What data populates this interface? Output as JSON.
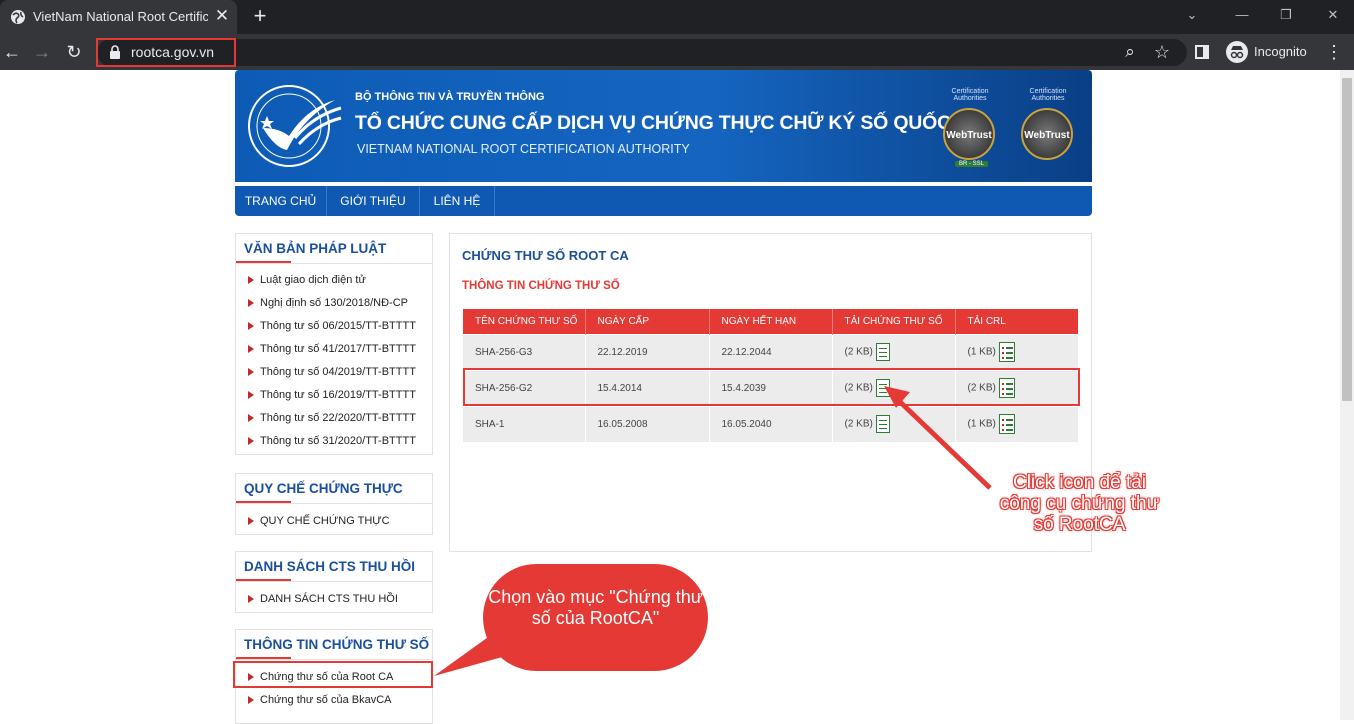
{
  "browser": {
    "tab_title": "VietNam National Root Certificate",
    "tab_close": "✕",
    "new_tab": "+",
    "url": "rootca.gov.vn",
    "incognito_label": "Incognito",
    "win_min": "—",
    "win_max": "❐",
    "win_close": "✕",
    "back": "←",
    "forward": "→",
    "reload": "↻",
    "zoom": "⌕",
    "star": "☆",
    "menu": "⋮"
  },
  "banner": {
    "ministry": "BỘ THÔNG TIN VÀ TRUYỀN THÔNG",
    "org_name": "TỔ CHỨC CUNG CẤP DỊCH VỤ CHỨNG THỰC CHỮ KÝ SỐ QUỐC GIA",
    "org_name_en": "VIETNAM NATIONAL ROOT CERTIFICATION AUTHORITY",
    "badge1_top": "Certification Authorities",
    "badge1_label": "WebTrust",
    "badge1_sub": "BR - SSL",
    "badge2_top": "Certification Authorities",
    "badge2_label": "WebTrust"
  },
  "nav": {
    "home": "TRANG CHỦ",
    "about": "GIỚI THIỆU",
    "contact": "LIÊN HỆ"
  },
  "sidebar": {
    "legal": {
      "title": "VĂN BẢN PHÁP LUẬT",
      "items": [
        "Luật giao dịch điện tử",
        "Nghị định số 130/2018/NĐ-CP",
        "Thông tư số 06/2015/TT-BTTTT",
        "Thông tư số 41/2017/TT-BTTTT",
        "Thông tư số 04/2019/TT-BTTTT",
        "Thông tư số 16/2019/TT-BTTTT",
        "Thông tư số 22/2020/TT-BTTTT",
        "Thông tư số 31/2020/TT-BTTTT"
      ]
    },
    "regulation": {
      "title": "QUY CHẾ CHỨNG THỰC",
      "items": [
        "QUY CHẾ CHỨNG THỰC"
      ]
    },
    "revoked": {
      "title": "DANH SÁCH CTS THU HỒI",
      "items": [
        "DANH SÁCH CTS THU HỒI"
      ]
    },
    "certinfo": {
      "title": "THÔNG TIN CHỨNG THƯ SỐ",
      "items": [
        "Chứng thư số của Root CA",
        "Chứng thư số của BkavCA"
      ]
    }
  },
  "main": {
    "title": "CHỨNG THƯ SỐ ROOT CA",
    "subtitle": "THÔNG TIN CHỨNG THƯ SỐ",
    "columns": [
      "TÊN CHỨNG THƯ SỐ",
      "NGÀY CẤP",
      "NGÀY HẾT HẠN",
      "TẢI CHỨNG THƯ SỐ",
      "TẢI CRL"
    ],
    "rows": [
      {
        "name": "SHA-256-G3",
        "issued": "22.12.2019",
        "expires": "22.12.2044",
        "cert_size": "(2 KB)",
        "crl_size": "(1 KB)"
      },
      {
        "name": "SHA-256-G2",
        "issued": "15.4.2014",
        "expires": "15.4.2039",
        "cert_size": "(2 KB)",
        "crl_size": "(2 KB)"
      },
      {
        "name": "SHA-1",
        "issued": "16.05.2008",
        "expires": "16.05.2040",
        "cert_size": "(2 KB)",
        "crl_size": "(1 KB)"
      }
    ]
  },
  "annotations": {
    "callout_download": "Click icon để tải công cụ chứng thư số RootCA",
    "bubble_select": "Chọn vào mục \"Chứng thư số của RootCA\""
  }
}
